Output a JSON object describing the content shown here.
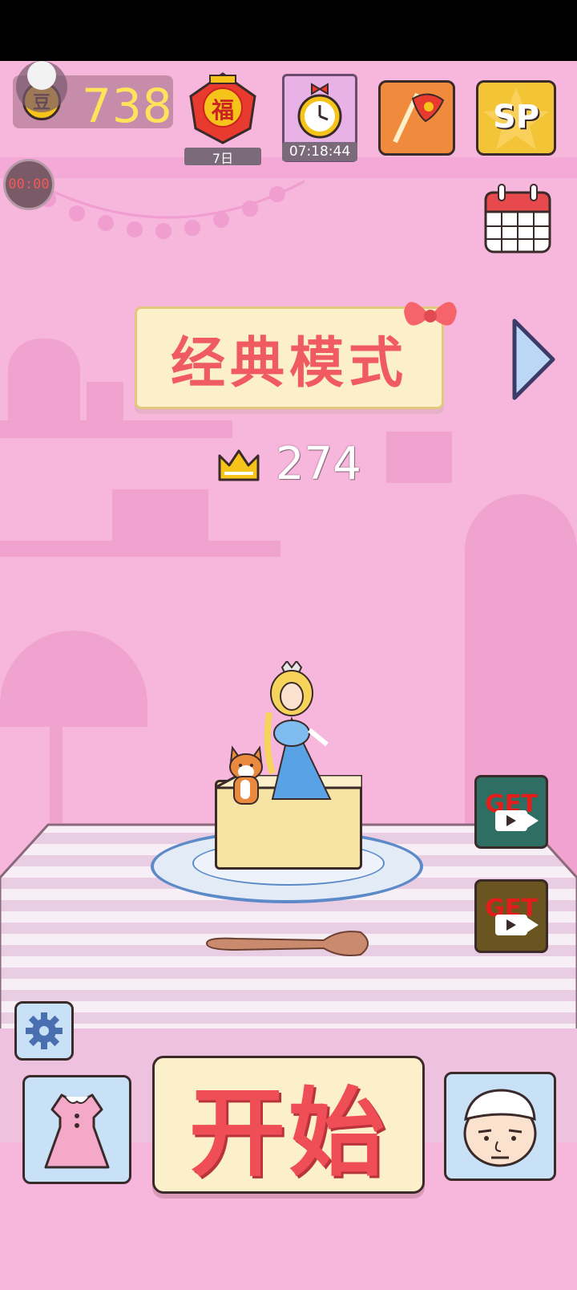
{
  "hud": {
    "coins": "738",
    "coin_icon_label": "豆",
    "timer": "00:00",
    "lantern_char": "福",
    "lantern_days": "7日",
    "clock_countdown": "07:18:44",
    "sp_label": "SP"
  },
  "mode": {
    "title": "经典模式",
    "best_score": "274"
  },
  "rewards": [
    {
      "label": "GET",
      "color": "#2f6e63"
    },
    {
      "label": "GET",
      "color": "#6a5520"
    }
  ],
  "start": {
    "label": "开始"
  },
  "icons": {
    "settings": "gear-icon",
    "dress": "dress-icon",
    "chef": "chef-icon",
    "calendar": "calendar-icon",
    "next": "chevron-right-icon"
  },
  "colors": {
    "background": "#f7b6dc",
    "accent_red": "#ef5b61",
    "tile_blue": "#c8e1f7",
    "coin_gold": "#f6c31b"
  }
}
